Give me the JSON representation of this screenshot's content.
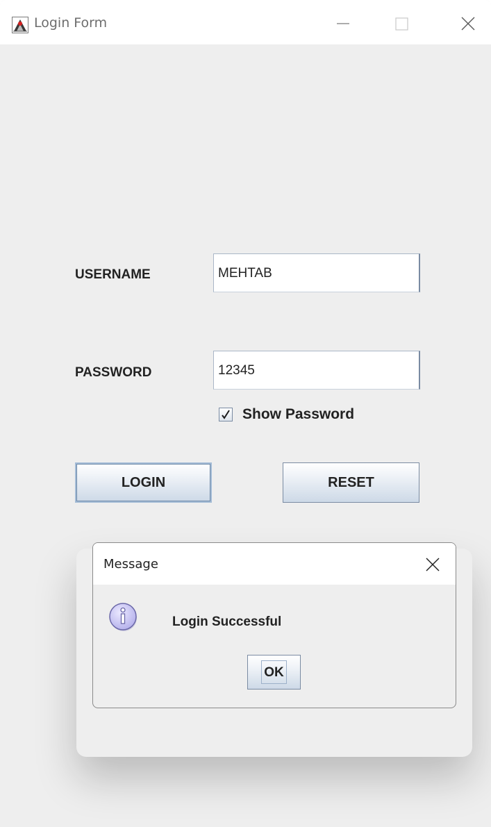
{
  "window": {
    "title": "Login Form",
    "icons": {
      "app": "java-duke-icon",
      "minimize": "minimize-icon",
      "maximize": "maximize-icon",
      "close": "close-icon"
    }
  },
  "form": {
    "username_label": "USERNAME",
    "username_value": "MEHTAB",
    "password_label": "PASSWORD",
    "password_value": "12345",
    "show_password_label": "Show Password",
    "show_password_checked": true,
    "login_label": "LOGIN",
    "reset_label": "RESET"
  },
  "dialog": {
    "title": "Message",
    "message": "Login Successful",
    "ok_label": "OK",
    "icon": "info-icon"
  },
  "colors": {
    "window_bg": "#eeeeee",
    "titlebar_bg": "#ffffff",
    "button_border": "#7a8ba2",
    "info_icon_fill": "#c9c6f2"
  }
}
